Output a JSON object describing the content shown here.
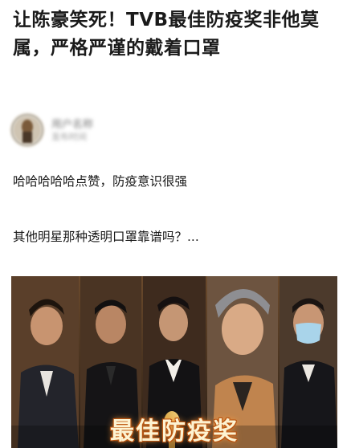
{
  "article": {
    "title": "让陈豪笑死！TVB最佳防疫奖非他莫属，严格严谨的戴着口罩",
    "author": {
      "name": "用户名称",
      "date": "发布时间"
    },
    "paragraphs": [
      "哈哈哈哈哈点赞，防疫意识很强",
      "其他明星那种透明口罩靠谱吗？..."
    ],
    "image": {
      "caption": "最佳防疫奖"
    }
  },
  "colors": {
    "title_text": "#1a1a1a",
    "body_text": "#1a1a1a",
    "caption_text": "#fdf3d2",
    "caption_glow": "#c9661a",
    "mask_blue": "#a9d4ea"
  }
}
